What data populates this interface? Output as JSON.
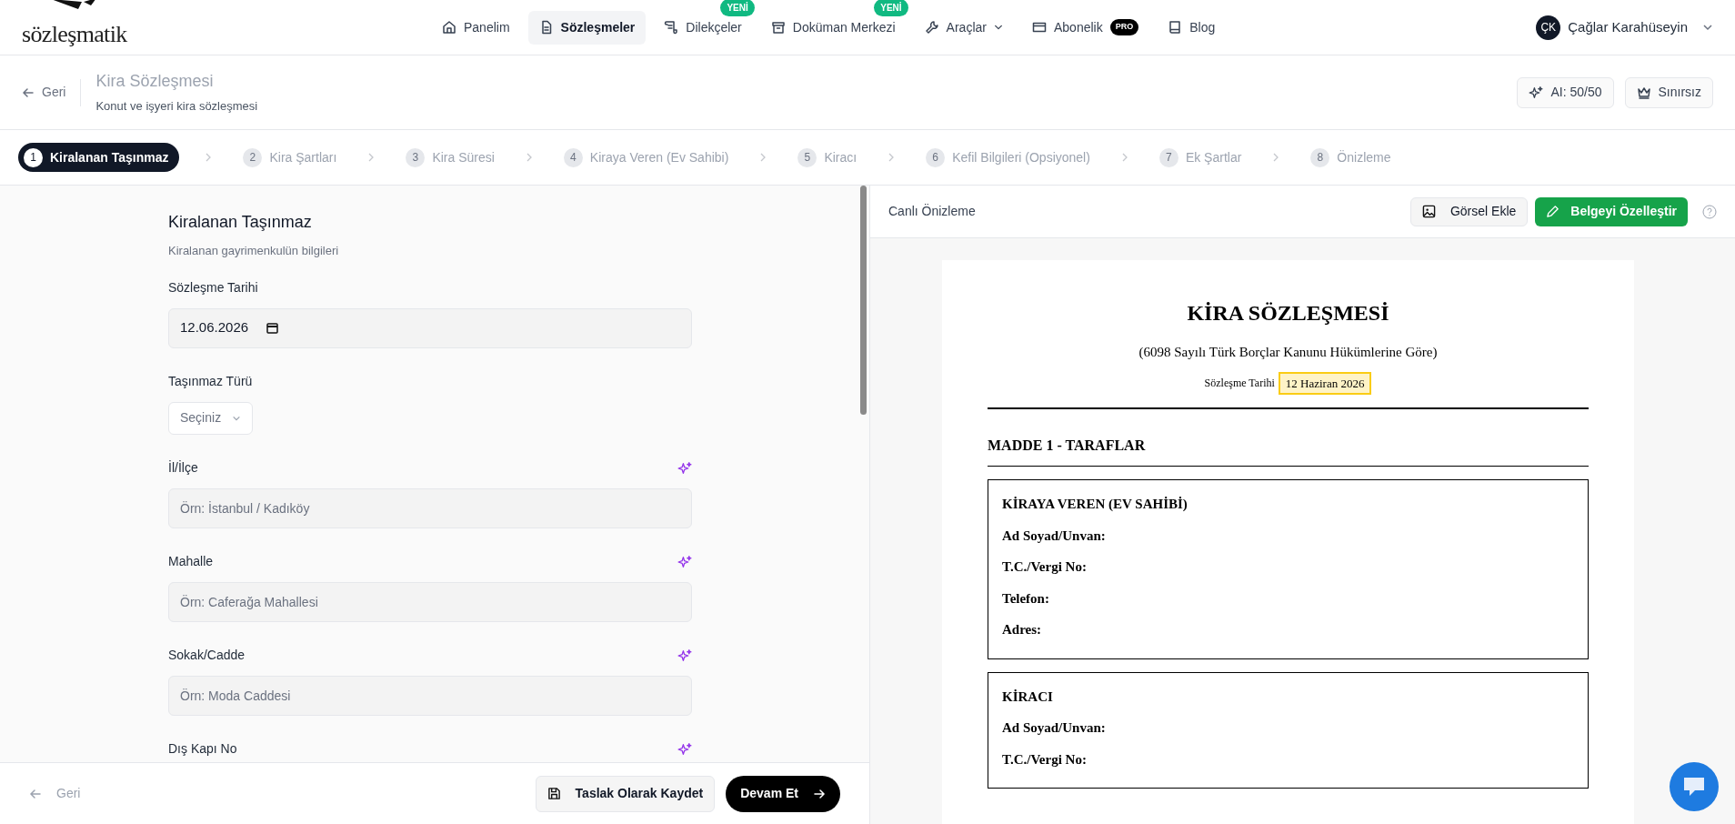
{
  "logo": {
    "text": "sözleşmatik"
  },
  "nav": [
    {
      "label": "Panelim",
      "selected": false
    },
    {
      "label": "Sözleşmeler",
      "selected": true
    },
    {
      "label": "Dilekçeler",
      "selected": false,
      "badge": "YENİ"
    },
    {
      "label": "Doküman Merkezi",
      "selected": false,
      "badge": "YENİ"
    },
    {
      "label": "Araçlar",
      "selected": false,
      "dropdown": true
    },
    {
      "label": "Abonelik",
      "selected": false,
      "pro": "PRO"
    },
    {
      "label": "Blog",
      "selected": false
    }
  ],
  "user": {
    "initials": "ÇK",
    "name": "Çağlar Karahüseyin"
  },
  "header": {
    "back": "Geri",
    "title": "Kira Sözleşmesi",
    "subtitle": "Konut ve işyeri kira sözleşmesi",
    "ai_credits": "AI: 50/50",
    "plan": "Sınırsız"
  },
  "steps": [
    {
      "number": "1",
      "label": "Kiralanan Taşınmaz",
      "selected": true
    },
    {
      "number": "2",
      "label": "Kira Şartları",
      "selected": false
    },
    {
      "number": "3",
      "label": "Kira Süresi",
      "selected": false
    },
    {
      "number": "4",
      "label": "Kiraya Veren (Ev Sahibi)",
      "selected": false
    },
    {
      "number": "5",
      "label": "Kiracı",
      "selected": false
    },
    {
      "number": "6",
      "label": "Kefil Bilgileri (Opsiyonel)",
      "selected": false
    },
    {
      "number": "7",
      "label": "Ek Şartlar",
      "selected": false
    },
    {
      "number": "8",
      "label": "Önizleme",
      "selected": false
    }
  ],
  "form": {
    "title": "Kiralanan Taşınmaz",
    "subtitle": "Kiralanan gayrimenkulün bilgileri",
    "fields": [
      {
        "kind": "date",
        "label": "Sözleşme Tarihi",
        "value": "12.06.2026",
        "ai_assist": false
      },
      {
        "kind": "select",
        "label": "Taşınmaz Türü",
        "value": "Seçiniz",
        "ai_assist": false
      },
      {
        "kind": "text",
        "label": "İl/İlçe",
        "placeholder": "Örn: İstanbul / Kadıköy",
        "ai_assist": true
      },
      {
        "kind": "text",
        "label": "Mahalle",
        "placeholder": "Örn: Caferağa Mahallesi",
        "ai_assist": true
      },
      {
        "kind": "text",
        "label": "Sokak/Cadde",
        "placeholder": "Örn: Moda Caddesi",
        "ai_assist": true
      },
      {
        "kind": "text",
        "label": "Dış Kapı No",
        "ai_assist": true
      }
    ]
  },
  "footer": {
    "back": "Geri",
    "save_draft": "Taslak Olarak Kaydet",
    "next": "Devam Et"
  },
  "preview": {
    "label": "Canlı Önizleme",
    "add_image": "Görsel Ekle",
    "customize": "Belgeyi Özelleştir",
    "document": {
      "title": "KİRA SÖZLEŞMESİ",
      "subtitle": "(6098 Sayılı Türk Borçlar Kanunu Hükümlerine Göre)",
      "date_label": "Sözleşme Tarihi",
      "date_value": "12 Haziran 2026",
      "section": "MADDE 1 - TARAFLAR",
      "parties": [
        {
          "heading": "KİRAYA VEREN (EV SAHİBİ)",
          "fields": [
            "Ad Soyad/Unvan:",
            "T.C./Vergi No:",
            "Telefon:",
            "Adres:"
          ]
        },
        {
          "heading": "KİRACI",
          "fields": [
            "Ad Soyad/Unvan:",
            "T.C./Vergi No:"
          ]
        }
      ]
    }
  }
}
